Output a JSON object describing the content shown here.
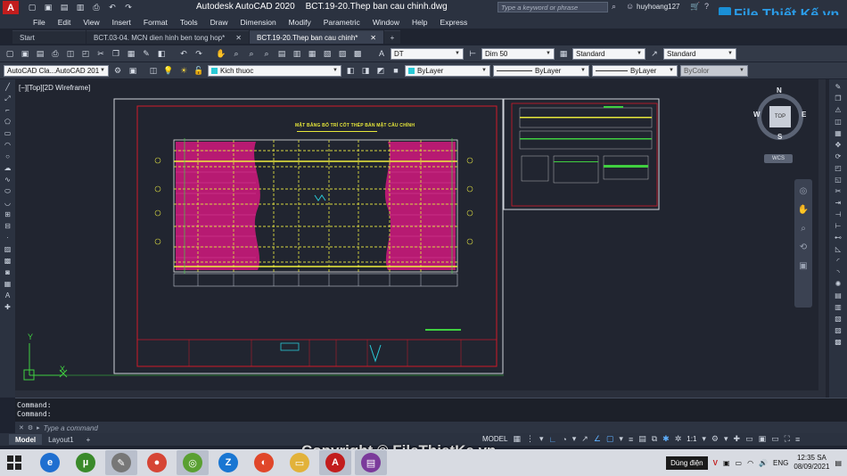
{
  "app": {
    "logo": "A",
    "title": "Autodesk AutoCAD 2020",
    "filename": "BCT.19-20.Thep ban cau chinh.dwg",
    "search_placeholder": "Type a keyword or phrase",
    "user": "huyhoang127",
    "watermark_brand": "File Thiết Kế.vn"
  },
  "menu": [
    "File",
    "Edit",
    "View",
    "Insert",
    "Format",
    "Tools",
    "Draw",
    "Dimension",
    "Modify",
    "Parametric",
    "Window",
    "Help",
    "Express"
  ],
  "tabs": [
    {
      "label": "Start"
    },
    {
      "label": "BCT.03-04. MCN dien hinh ben tong hop*"
    },
    {
      "label": "BCT.19-20.Thep ban cau chinh*"
    }
  ],
  "toolbar1": {
    "textstyle": "DT",
    "dimstyle": "Dim 50",
    "tablestyle": "Standard",
    "mleaderstyle": "Standard"
  },
  "toolbar2": {
    "workspace": "AutoCAD Cla...AutoCAD 201",
    "layer": "Kich thuoc",
    "color": "ByLayer",
    "linetype": "ByLayer",
    "lineweight": "ByLayer",
    "plotstyle": "ByColor"
  },
  "viewport": {
    "label": "[−][Top][2D Wireframe]",
    "drawing_title": "MẶT BẰNG BỐ TRÍ CỐT THÉP BẢN MẶT CẦU CHÍNH",
    "cube": {
      "n": "N",
      "s": "S",
      "e": "E",
      "w": "W",
      "top": "TOP",
      "wcs": "WCS"
    },
    "ucs": {
      "x": "X",
      "y": "Y"
    }
  },
  "command": {
    "history": [
      "Command:",
      "Command:"
    ],
    "placeholder": "Type a command"
  },
  "layouts": {
    "model": "Model",
    "layout1": "Layout1",
    "add": "+"
  },
  "status": {
    "mode": "MODEL",
    "scale": "1:1"
  },
  "watermark": "Copyright © FileThietKe.vn",
  "taskbar": {
    "tooltip": "Dùng điện",
    "lang": "ENG",
    "time": "12:35 SA",
    "date": "08/09/2021",
    "apps": [
      {
        "name": "ie",
        "glyph": "e",
        "color": "#1f6fd0"
      },
      {
        "name": "utorrent",
        "glyph": "µ",
        "color": "#3a8a2a"
      },
      {
        "name": "tool",
        "glyph": "✎",
        "color": "#777"
      },
      {
        "name": "chrome",
        "glyph": "●",
        "color": "#d64535"
      },
      {
        "name": "corel",
        "glyph": "◎",
        "color": "#5aa032"
      },
      {
        "name": "zalo",
        "glyph": "Z",
        "color": "#1976d2"
      },
      {
        "name": "coccoc",
        "glyph": "◐",
        "color": "#e0472a"
      },
      {
        "name": "explorer",
        "glyph": "▭",
        "color": "#e2b23a"
      },
      {
        "name": "autocad",
        "glyph": "A",
        "color": "#c21d1d"
      },
      {
        "name": "winrar",
        "glyph": "▤",
        "color": "#7b3a9b"
      }
    ]
  }
}
